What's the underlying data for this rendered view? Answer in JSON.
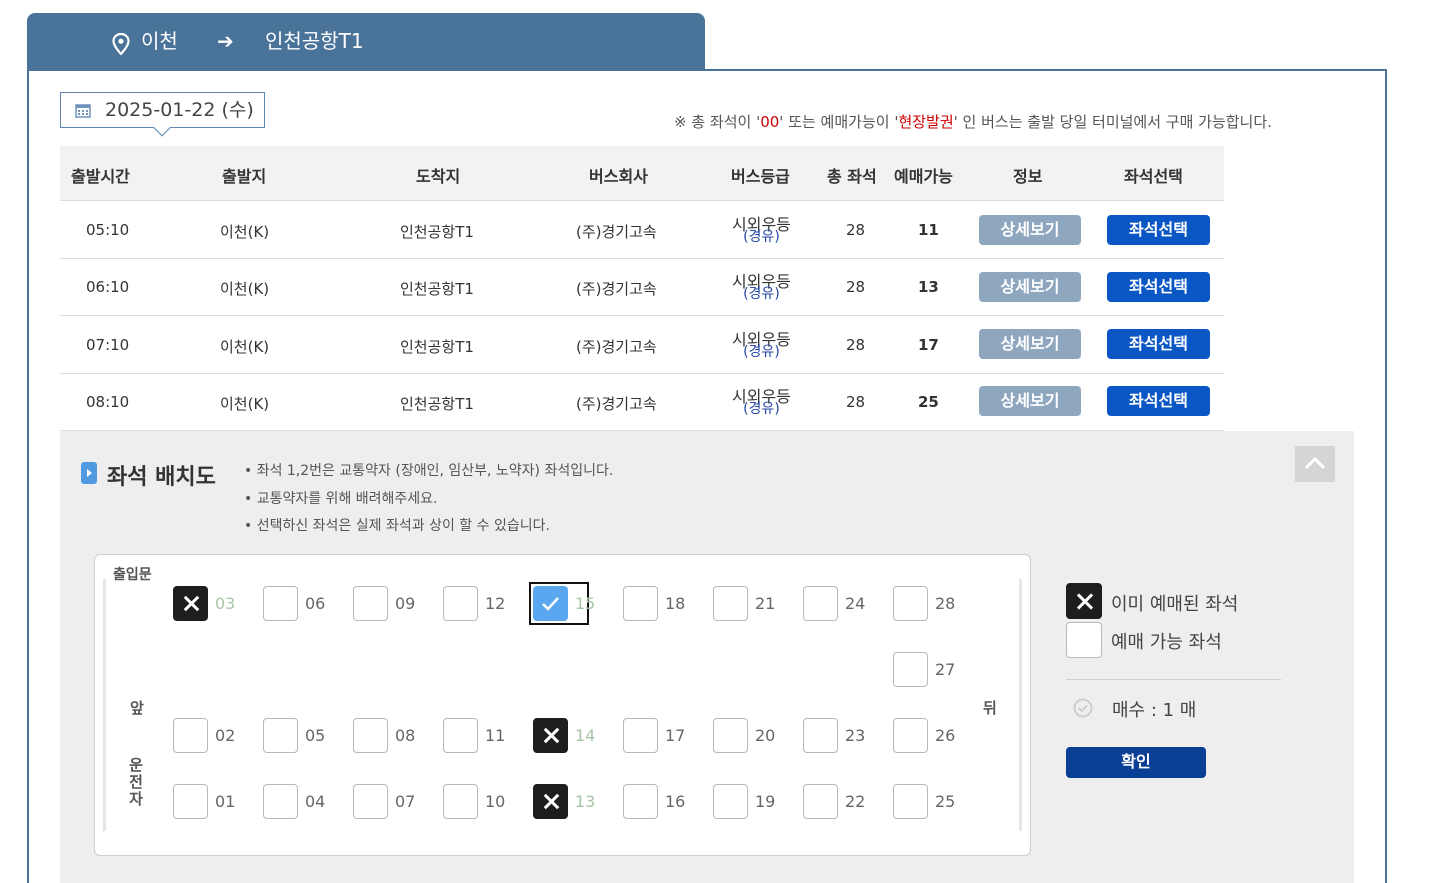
{
  "route": {
    "from": "이천",
    "arrow": "➔",
    "to": "인천공항T1"
  },
  "date": "2025-01-22 (수)",
  "notice": {
    "pre": "※ 총 좌석이 '",
    "code": "00",
    "mid": "' 또는 예매가능이 '",
    "onsite": "현장발권",
    "post": "' 인 버스는 출발 당일 터미널에서 구매 가능합니다."
  },
  "table": {
    "headers": {
      "depart_time": "출발시간",
      "origin": "출발지",
      "destination": "도착지",
      "company": "버스회사",
      "grade": "버스등급",
      "total_seats": "총 좌석",
      "available": "예매가능",
      "info": "정보",
      "seat_select": "좌석선택"
    },
    "rows": [
      {
        "time": "05:10",
        "origin": "이천(K)",
        "destination": "인천공항T1",
        "company": "(주)경기고속",
        "grade": "시외우등",
        "grade_sub": "(경유)",
        "total": "28",
        "available": "11",
        "detail": "상세보기",
        "select": "좌석선택"
      },
      {
        "time": "06:10",
        "origin": "이천(K)",
        "destination": "인천공항T1",
        "company": "(주)경기고속",
        "grade": "시외우등",
        "grade_sub": "(경유)",
        "total": "28",
        "available": "13",
        "detail": "상세보기",
        "select": "좌석선택"
      },
      {
        "time": "07:10",
        "origin": "이천(K)",
        "destination": "인천공항T1",
        "company": "(주)경기고속",
        "grade": "시외우등",
        "grade_sub": "(경유)",
        "total": "28",
        "available": "17",
        "detail": "상세보기",
        "select": "좌석선택"
      },
      {
        "time": "08:10",
        "origin": "이천(K)",
        "destination": "인천공항T1",
        "company": "(주)경기고속",
        "grade": "시외우등",
        "grade_sub": "(경유)",
        "total": "28",
        "available": "25",
        "detail": "상세보기",
        "select": "좌석선택"
      }
    ]
  },
  "seat_layout": {
    "title": "좌석 배치도",
    "notes": [
      "• 좌석 1,2번은 교통약자 (장애인, 임산부, 노약자) 좌석입니다.",
      "• 교통약자를 위해 배려해주세요.",
      "• 선택하신 좌석은 실제 좌석과 상이 할 수 있습니다."
    ],
    "door_label": "출입문",
    "front_label": "앞",
    "back_label": "뒤",
    "driver_label": "운전자",
    "seats": {
      "s01": {
        "num": "01",
        "status": "available"
      },
      "s02": {
        "num": "02",
        "status": "available"
      },
      "s03": {
        "num": "03",
        "status": "taken"
      },
      "s04": {
        "num": "04",
        "status": "available"
      },
      "s05": {
        "num": "05",
        "status": "available"
      },
      "s06": {
        "num": "06",
        "status": "available"
      },
      "s07": {
        "num": "07",
        "status": "available"
      },
      "s08": {
        "num": "08",
        "status": "available"
      },
      "s09": {
        "num": "09",
        "status": "available"
      },
      "s10": {
        "num": "10",
        "status": "available"
      },
      "s11": {
        "num": "11",
        "status": "available"
      },
      "s12": {
        "num": "12",
        "status": "available"
      },
      "s13": {
        "num": "13",
        "status": "taken"
      },
      "s14": {
        "num": "14",
        "status": "taken"
      },
      "s15": {
        "num": "15",
        "status": "selected"
      },
      "s16": {
        "num": "16",
        "status": "available"
      },
      "s17": {
        "num": "17",
        "status": "available"
      },
      "s18": {
        "num": "18",
        "status": "available"
      },
      "s19": {
        "num": "19",
        "status": "available"
      },
      "s20": {
        "num": "20",
        "status": "available"
      },
      "s21": {
        "num": "21",
        "status": "available"
      },
      "s22": {
        "num": "22",
        "status": "available"
      },
      "s23": {
        "num": "23",
        "status": "available"
      },
      "s24": {
        "num": "24",
        "status": "available"
      },
      "s25": {
        "num": "25",
        "status": "available"
      },
      "s26": {
        "num": "26",
        "status": "available"
      },
      "s27": {
        "num": "27",
        "status": "available"
      },
      "s28": {
        "num": "28",
        "status": "available"
      }
    }
  },
  "legend": {
    "taken": "이미 예매된 좌석",
    "available": "예매 가능 좌석",
    "count": "매수 : 1 매",
    "confirm": "확인"
  },
  "colors": {
    "header_tab": "#4a7399",
    "select_button": "#0a56c4",
    "detail_button": "#8ea7bf",
    "confirm_button": "#0a3f96",
    "taken_seat": "#1e1e1e",
    "selected_seat": "#5aa7f0",
    "notice_red": "#cc0000"
  }
}
